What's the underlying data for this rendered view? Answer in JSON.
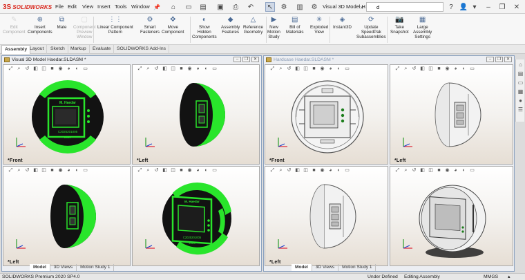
{
  "app": {
    "logo_text": "SOLIDWORKS",
    "menu": [
      "File",
      "Edit",
      "View",
      "Insert",
      "Tools",
      "Window"
    ],
    "document_title": "Visual 3D Model H...",
    "search_value": "d"
  },
  "ribbon": {
    "buttons": [
      {
        "label": "Edit\nComponent",
        "icon": "edit-component-icon",
        "disabled": true
      },
      {
        "label": "Insert\nComponents",
        "icon": "insert-components-icon",
        "disabled": false
      },
      {
        "label": "Mate",
        "icon": "mate-icon",
        "disabled": false
      },
      {
        "label": "Component\nPreview\nWindow",
        "icon": "component-preview-icon",
        "disabled": true
      },
      {
        "label": "Linear Component\nPattern",
        "icon": "linear-pattern-icon",
        "disabled": false
      },
      {
        "label": "Smart\nFasteners",
        "icon": "smart-fasteners-icon",
        "disabled": false
      },
      {
        "label": "Move\nComponent",
        "icon": "move-component-icon",
        "disabled": false
      },
      {
        "label": "Show\nHidden\nComponents",
        "icon": "show-hidden-icon",
        "disabled": false
      },
      {
        "label": "Assembly\nFeatures",
        "icon": "assembly-features-icon",
        "disabled": false
      },
      {
        "label": "Reference\nGeometry",
        "icon": "reference-geometry-icon",
        "disabled": false
      },
      {
        "label": "New\nMotion\nStudy",
        "icon": "motion-study-icon",
        "disabled": false
      },
      {
        "label": "Bill of\nMaterials",
        "icon": "bom-icon",
        "disabled": false
      },
      {
        "label": "Exploded\nView",
        "icon": "exploded-view-icon",
        "disabled": false
      },
      {
        "label": "Instant3D",
        "icon": "instant3d-icon",
        "disabled": false
      },
      {
        "label": "Update\nSpeedPak\nSubassemblies",
        "icon": "speedpak-icon",
        "disabled": false
      },
      {
        "label": "Take\nSnapshot",
        "icon": "camera-icon",
        "disabled": false
      },
      {
        "label": "Large\nAssembly\nSettings",
        "icon": "large-assembly-icon",
        "disabled": false
      }
    ]
  },
  "command_tabs": [
    "Assembly",
    "Layout",
    "Sketch",
    "Markup",
    "Evaluate",
    "SOLIDWORKS Add-Ins"
  ],
  "left_window": {
    "title": "Visual 3D Model Haedar.SLDASM *",
    "viewports": [
      {
        "label": "*Front",
        "view": "front"
      },
      {
        "label": "*Left",
        "view": "left"
      },
      {
        "label": "*Left",
        "view": "left"
      },
      {
        "label": "",
        "view": "iso"
      }
    ],
    "model_text": {
      "name": "M. Haedar",
      "id": "C2025201005",
      "year": "2024"
    },
    "bottom_tabs": [
      "Model",
      "3D Views",
      "Motion Study 1"
    ]
  },
  "right_window": {
    "title": "Hardcase Haedar.SLDASM *",
    "viewports": [
      {
        "label": "*Front",
        "view": "front"
      },
      {
        "label": "*Left",
        "view": "left"
      },
      {
        "label": "*Left",
        "view": "left"
      },
      {
        "label": "",
        "view": "iso"
      }
    ],
    "bottom_tabs": [
      "Model",
      "3D Views",
      "Motion Study 1"
    ]
  },
  "status": {
    "product": "SOLIDWORKS Premium 2020 SP4.0",
    "definition": "Under Defined",
    "mode": "Editing Assembly",
    "units": "MMGS"
  },
  "colors": {
    "accent_green": "#29e52b",
    "body_black": "#121212",
    "title_red": "#d9261c"
  }
}
